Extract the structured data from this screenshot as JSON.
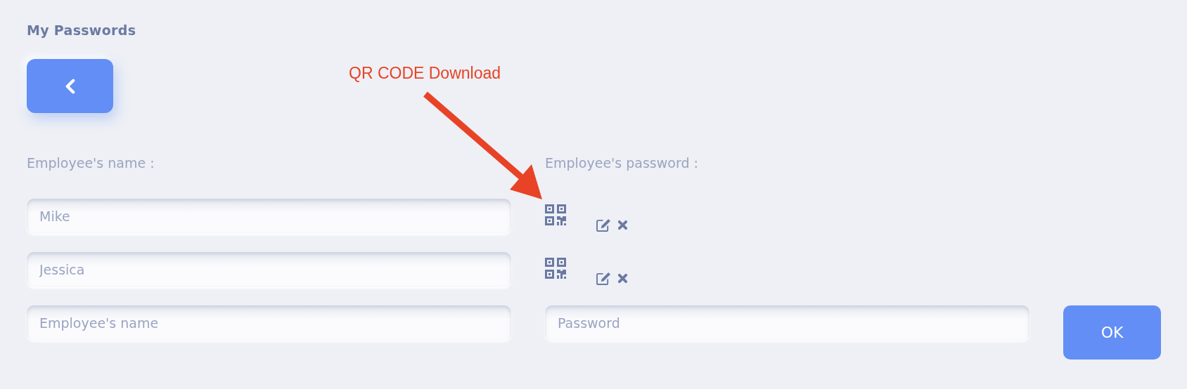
{
  "title": "My Passwords",
  "annotation": {
    "text": "QR CODE Download"
  },
  "labels": {
    "name": "Employee's name :",
    "password": "Employee's password :"
  },
  "employees": [
    {
      "name": "Mike"
    },
    {
      "name": "Jessica"
    }
  ],
  "new_entry": {
    "name_placeholder": "Employee's name",
    "password_placeholder": "Password",
    "button": "OK"
  }
}
